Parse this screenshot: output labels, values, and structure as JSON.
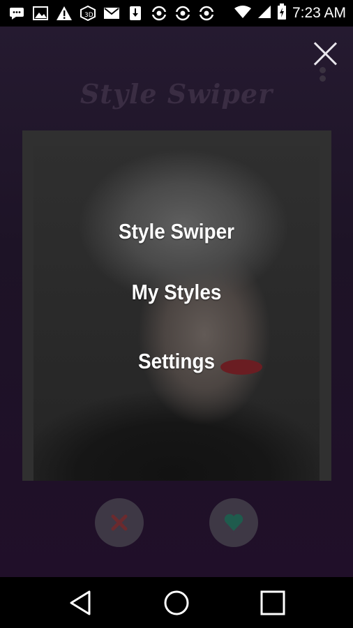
{
  "status_bar": {
    "time": "7:23 AM",
    "icons": [
      "message-icon",
      "image-icon",
      "warning-icon",
      "cube-icon",
      "mail-icon",
      "download-icon",
      "sync-icon",
      "sync-icon",
      "sync-icon",
      "wifi-icon",
      "signal-icon",
      "battery-icon"
    ]
  },
  "app": {
    "title": "Style Swiper",
    "menu": {
      "items": [
        "Style Swiper",
        "My Styles",
        "Settings"
      ]
    },
    "actions": {
      "dislike_color": "#6b2a2e",
      "like_color": "#1f5b4d"
    }
  },
  "nav_bar": {
    "icons": [
      "back-icon",
      "home-icon",
      "recents-icon"
    ]
  }
}
